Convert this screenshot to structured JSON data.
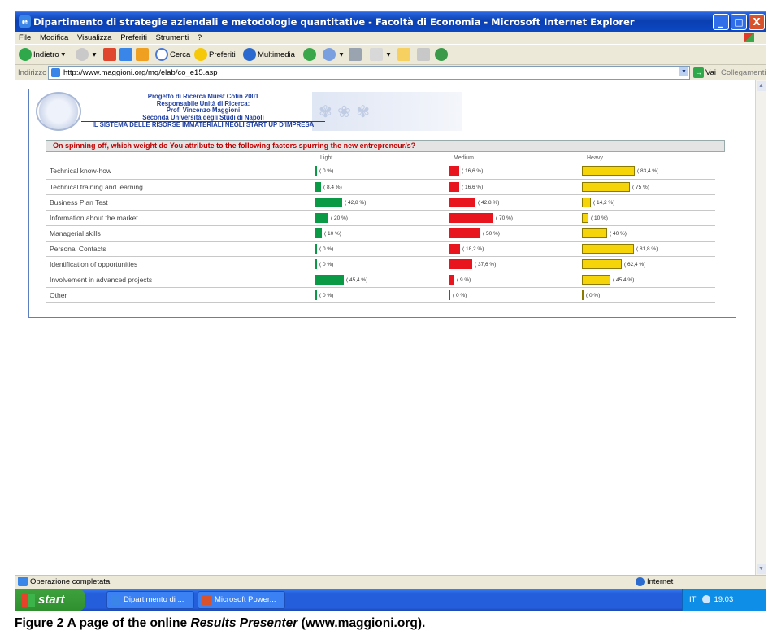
{
  "window": {
    "title": "Dipartimento di strategie aziendali e metodologie quantitative - Facoltà di Economia - Microsoft Internet Explorer",
    "buttons": {
      "minimize": "_",
      "maximize": "□",
      "close": "X"
    }
  },
  "menu": [
    "File",
    "Modifica",
    "Visualizza",
    "Preferiti",
    "Strumenti",
    "?"
  ],
  "toolbar": {
    "back": "Indietro",
    "search": "Cerca",
    "favorites": "Preferiti",
    "multimedia": "Multimedia"
  },
  "address": {
    "label": "Indirizzo",
    "url": "http://www.maggioni.org/mq/elab/co_e15.asp",
    "go": "Vai",
    "links": "Collegamenti",
    "more": "»"
  },
  "banner": {
    "line1": "Progetto di Ricerca Murst Cofin 2001",
    "line2": "Responsabile Unità di Ricerca:",
    "line3": "Prof. Vincenzo Maggioni",
    "line4": "Seconda Università degli Studi di Napoli",
    "line5": "IL SISTEMA DELLE RISORSE IMMATERIALI NEGLI START UP D'IMPRESA"
  },
  "survey": {
    "question": "On spinning off, which weight do You attribute to the following factors spurring the new entrepreneur/s?",
    "columns": [
      "Light",
      "Medium",
      "Heavy"
    ],
    "colors": {
      "light": "#0a9a46",
      "medium": "#e8151f",
      "heavy": "#f6d40a"
    },
    "rows": [
      {
        "factor": "Technical know-how",
        "light": 0,
        "medium": 16.6,
        "heavy": 83.4,
        "light_label": "( 0 %)",
        "medium_label": "( 16,6 %)",
        "heavy_label": "( 83,4 %)"
      },
      {
        "factor": "Technical training and learning",
        "light": 8.4,
        "medium": 16.6,
        "heavy": 75,
        "light_label": "( 8,4 %)",
        "medium_label": "( 16,6 %)",
        "heavy_label": "( 75 %)"
      },
      {
        "factor": "Business Plan Test",
        "light": 42.8,
        "medium": 42.8,
        "heavy": 14.2,
        "light_label": "( 42,8 %)",
        "medium_label": "( 42,8 %)",
        "heavy_label": "( 14,2 %)"
      },
      {
        "factor": "Information about the market",
        "light": 20,
        "medium": 70,
        "heavy": 10,
        "light_label": "( 20 %)",
        "medium_label": "( 70 %)",
        "heavy_label": "( 10 %)"
      },
      {
        "factor": "Managerial skills",
        "light": 10,
        "medium": 50,
        "heavy": 40,
        "light_label": "( 10 %)",
        "medium_label": "( 50 %)",
        "heavy_label": "( 40 %)"
      },
      {
        "factor": "Personal Contacts",
        "light": 0,
        "medium": 18.2,
        "heavy": 81.8,
        "light_label": "( 0 %)",
        "medium_label": "( 18,2 %)",
        "heavy_label": "( 81,8 %)"
      },
      {
        "factor": "Identification of opportunities",
        "light": 0,
        "medium": 37.6,
        "heavy": 62.4,
        "light_label": "( 0 %)",
        "medium_label": "( 37,6 %)",
        "heavy_label": "( 62,4 %)"
      },
      {
        "factor": "Involvement in advanced projects",
        "light": 45.4,
        "medium": 9,
        "heavy": 45.4,
        "light_label": "( 45,4 %)",
        "medium_label": "( 9 %)",
        "heavy_label": "( 45,4 %)"
      },
      {
        "factor": "Other",
        "light": 0,
        "medium": 0,
        "heavy": 0,
        "light_label": "( 0 %)",
        "medium_label": "( 0 %)",
        "heavy_label": "( 0 %)"
      }
    ]
  },
  "status": {
    "text": "Operazione completata",
    "zone": "Internet"
  },
  "taskbar": {
    "start": "start",
    "items": [
      "Dipartimento di ...",
      "Microsoft Power..."
    ],
    "lang": "IT",
    "clock": "19.03"
  },
  "caption": {
    "prefix": "Figure 2",
    "text1": "A page of the online",
    "italic": "Results Presenter",
    "text2": "(www.maggioni.org)."
  }
}
